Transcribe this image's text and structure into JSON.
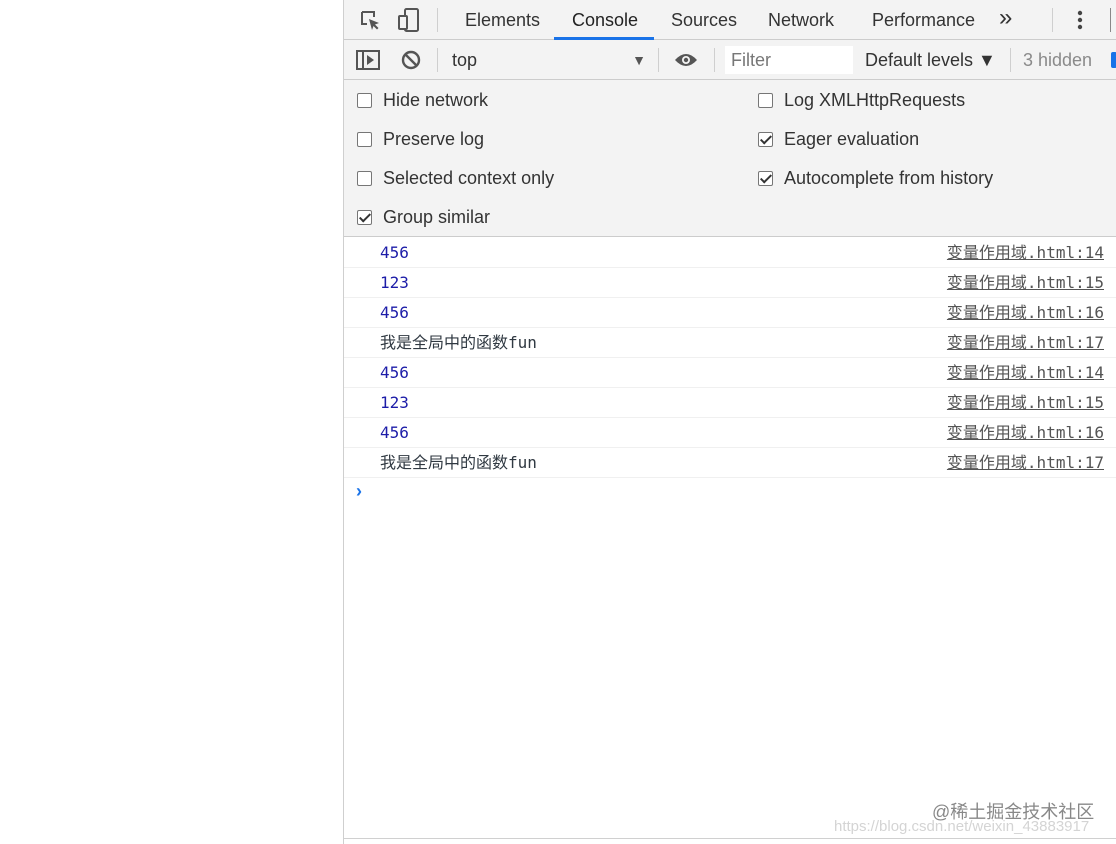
{
  "tabs": {
    "items": [
      "Elements",
      "Console",
      "Sources",
      "Network",
      "Performance"
    ],
    "active": "Console",
    "more_glyph": "»"
  },
  "console_toolbar": {
    "context": "top",
    "filter_placeholder": "Filter",
    "levels": "Default levels ▼",
    "hidden": "3 hidden"
  },
  "settings": {
    "left": [
      {
        "label": "Hide network",
        "checked": false
      },
      {
        "label": "Preserve log",
        "checked": false
      },
      {
        "label": "Selected context only",
        "checked": false
      },
      {
        "label": "Group similar",
        "checked": true
      }
    ],
    "right": [
      {
        "label": "Log XMLHttpRequests",
        "checked": false
      },
      {
        "label": "Eager evaluation",
        "checked": true
      },
      {
        "label": "Autocomplete from history",
        "checked": true
      }
    ]
  },
  "messages": [
    {
      "text": "456",
      "kind": "number",
      "source": "变量作用域.html:14"
    },
    {
      "text": "123",
      "kind": "number",
      "source": "变量作用域.html:15"
    },
    {
      "text": "456",
      "kind": "number",
      "source": "变量作用域.html:16"
    },
    {
      "text": "我是全局中的函数fun",
      "kind": "string",
      "source": "变量作用域.html:17"
    },
    {
      "text": "456",
      "kind": "number",
      "source": "变量作用域.html:14"
    },
    {
      "text": "123",
      "kind": "number",
      "source": "变量作用域.html:15"
    },
    {
      "text": "456",
      "kind": "number",
      "source": "变量作用域.html:16"
    },
    {
      "text": "我是全局中的函数fun",
      "kind": "string",
      "source": "变量作用域.html:17"
    }
  ],
  "prompt_glyph": "›",
  "watermark": "@稀土掘金技术社区",
  "watermark_url": "https://blog.csdn.net/weixin_43883917",
  "colors": {
    "accent": "#1a73e8",
    "number": "#1c1ca8",
    "toolbar_bg": "#f3f3f3"
  },
  "icons": [
    "inspect-element-icon",
    "device-toolbar-icon",
    "more-tabs-icon",
    "kebab-menu-icon",
    "sidebar-toggle-icon",
    "clear-console-icon",
    "eye-icon",
    "prompt-caret-icon",
    "settings-gear-icon"
  ]
}
